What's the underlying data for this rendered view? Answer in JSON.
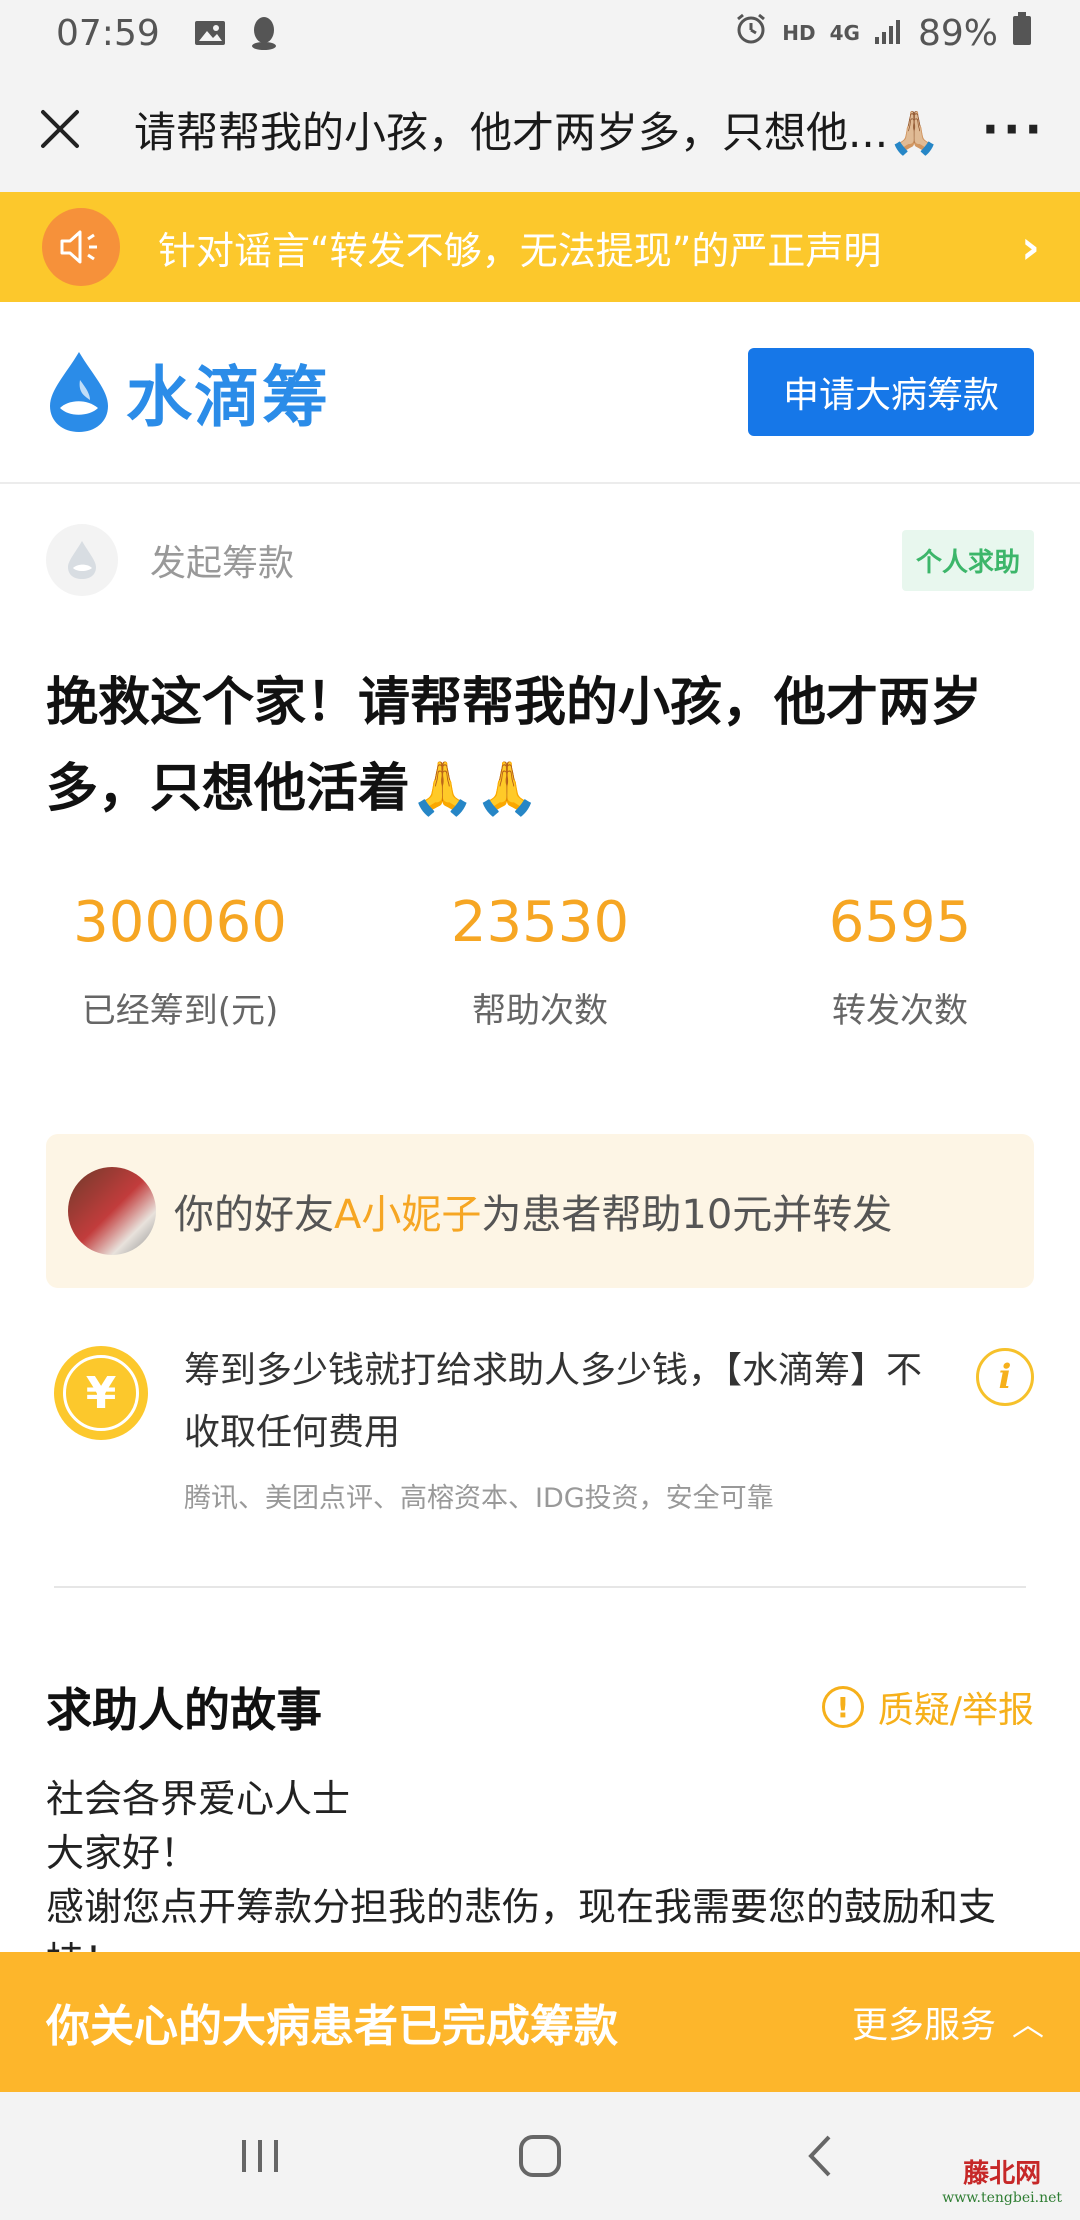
{
  "status_bar": {
    "time": "07:59",
    "hd_label": "HD",
    "network_label": "4G",
    "battery": "89%"
  },
  "title_bar": {
    "title": "请帮帮我的小孩，他才两岁多，只想他...🙏🏼",
    "more_label": "···"
  },
  "notice": {
    "text": "针对谣言“转发不够，无法提现”的严正声明",
    "arrow": "›"
  },
  "brand": {
    "name": "水滴筹",
    "apply_button": "申请大病筹款",
    "color": "#2b8ce8"
  },
  "initiator": {
    "label": "发起筹款",
    "tag": "个人求助"
  },
  "headline": "挽救这个家！请帮帮我的小孩，他才两岁多，只想他活着🙏🙏",
  "stats": [
    {
      "value": "300060",
      "label": "已经筹到(元)"
    },
    {
      "value": "23530",
      "label": "帮助次数"
    },
    {
      "value": "6595",
      "label": "转发次数"
    }
  ],
  "friend": {
    "prefix": "你的好友",
    "name": "A小妮子",
    "suffix": "为患者帮助10元并转发"
  },
  "guarantee": {
    "coin_symbol": "¥",
    "main_text": "筹到多少钱就打给求助人多少钱，【水滴筹】不收取任何费用",
    "sub_text": "腾讯、美团点评、高榕资本、IDG投资，安全可靠",
    "info_symbol": "i"
  },
  "story": {
    "title": "求助人的故事",
    "report_label": "质疑/举报",
    "warn_symbol": "!",
    "lines": [
      "社会各界爱心人士",
      "大家好！",
      "感谢您点开筹款分担我的悲伤，现在我需要您的鼓励和支持！"
    ]
  },
  "done_bar": {
    "text": "你关心的大病患者已完成筹款",
    "more_label": "更多服务",
    "up_arrow": "︿"
  },
  "watermark": {
    "name": "藤北网",
    "url": "www.tengbei.net"
  },
  "colors": {
    "accent_yellow": "#fcc82c",
    "stat_orange": "#f6a623",
    "brand_blue": "#1677e8",
    "tag_green": "#3cb66a"
  }
}
